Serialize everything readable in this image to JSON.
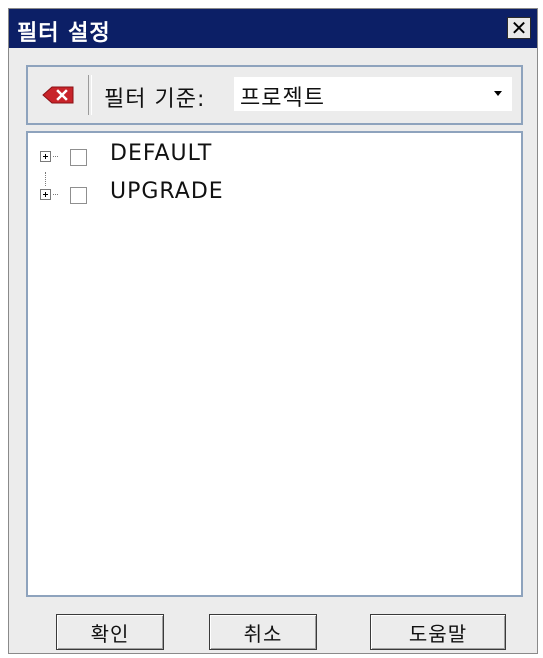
{
  "window": {
    "title": "필터 설정",
    "close_glyph": "✕"
  },
  "toolbar": {
    "remove_icon": "remove-filter-icon",
    "filter_label": "필터 기준:",
    "filter_select_value": "프로젝트"
  },
  "tree": {
    "items": [
      {
        "label": "DEFAULT",
        "expanded": false,
        "checked": false
      },
      {
        "label": "UPGRADE",
        "expanded": false,
        "checked": false
      }
    ]
  },
  "buttons": {
    "ok": "확인",
    "cancel": "취소",
    "help": "도움말"
  },
  "colors": {
    "titlebar": "#0c1f66",
    "panel_border": "#8ea3bd",
    "remove_icon": "#c8242a"
  }
}
